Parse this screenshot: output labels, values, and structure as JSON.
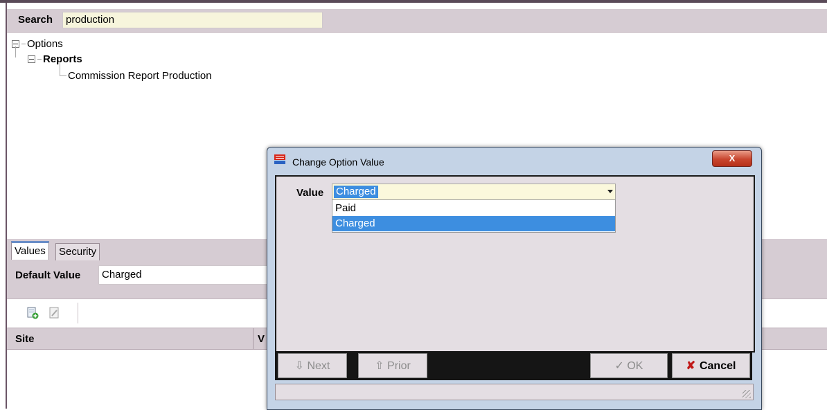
{
  "search": {
    "label": "Search",
    "value": "production"
  },
  "tree": {
    "root": "Options",
    "child": "Reports",
    "leaf": "Commission Report Production"
  },
  "tabs": [
    {
      "label": "Values",
      "active": true
    },
    {
      "label": "Security",
      "active": false
    }
  ],
  "default_value": {
    "label": "Default Value",
    "value": "Charged"
  },
  "toolbar": {
    "icons": [
      "add-page-icon",
      "edit-page-icon"
    ]
  },
  "grid": {
    "columns": [
      "Site",
      "V"
    ]
  },
  "dialog": {
    "title": "Change Option Value",
    "close_label": "X",
    "value_label": "Value",
    "selected": "Charged",
    "options": [
      "Paid",
      "Charged"
    ],
    "buttons": {
      "next": "Next",
      "prior": "Prior",
      "ok": "OK",
      "cancel": "Cancel"
    }
  }
}
